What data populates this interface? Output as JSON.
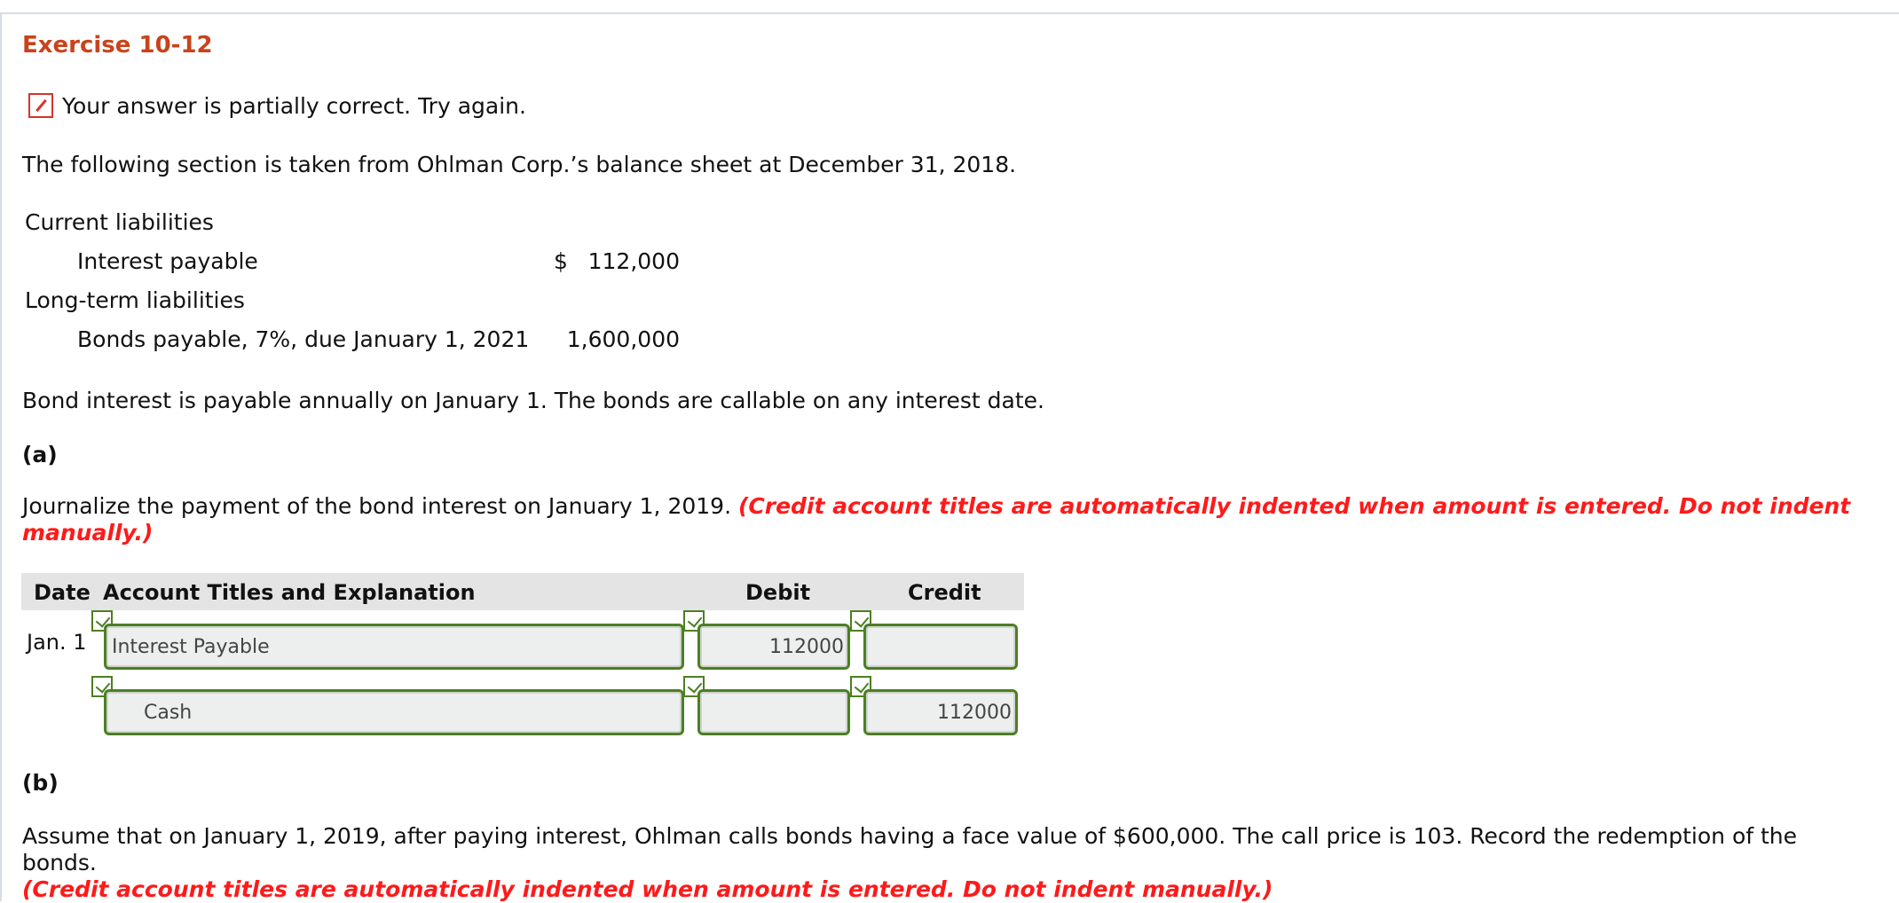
{
  "exercise_title": "Exercise 10-12",
  "feedback": {
    "icon": "pencil-icon",
    "message": "Your answer is partially correct.  Try again."
  },
  "intro": "The following section is taken from Ohlman Corp.’s balance sheet at December 31, 2018.",
  "balance_sheet": {
    "current_heading": "Current liabilities",
    "interest_label": "Interest payable",
    "interest_dollar": "$",
    "interest_value": "112,000",
    "longterm_heading": "Long-term liabilities",
    "bonds_label": "Bonds payable, 7%, due January 1, 2021",
    "bonds_value": "1,600,000"
  },
  "bond_note": "Bond interest is payable annually on January 1. The bonds are callable on any interest date.",
  "part_a": {
    "label": "(a)",
    "instruction": "Journalize the payment of the bond interest on January 1, 2019.",
    "note_line1": "(Credit account titles are automatically indented when amount is entered. Do not indent",
    "note_line2": "manually.)"
  },
  "journal": {
    "headers": {
      "date": "Date",
      "account": "Account Titles and Explanation",
      "debit": "Debit",
      "credit": "Credit"
    },
    "rows": [
      {
        "date": "Jan. 1",
        "account": "Interest Payable",
        "debit": "112000",
        "credit": ""
      },
      {
        "date": "",
        "account": "Cash",
        "debit": "",
        "credit": "112000"
      }
    ]
  },
  "part_b": {
    "label": "(b)",
    "instruction": "Assume that on January 1, 2019, after paying interest, Ohlman calls bonds having a face value of $600,000. The call price is 103. Record the redemption of the bonds.",
    "note": "(Credit account titles are automatically indented when amount is entered. Do not indent manually.)"
  },
  "colors": {
    "title": "#c8431c",
    "instruction_red": "#ff1a1a",
    "field_border": "#4c7f22",
    "header_bg": "#e4e4e4"
  }
}
